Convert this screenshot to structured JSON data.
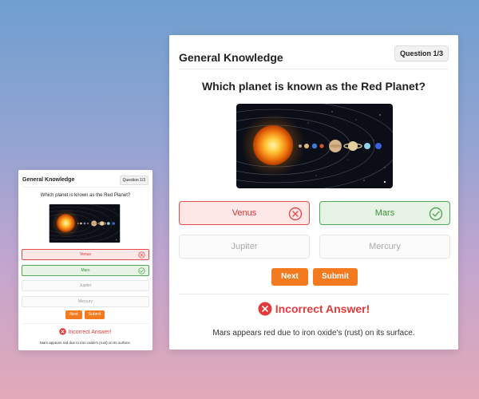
{
  "quiz": {
    "category": "General Knowledge",
    "question_counter": "Question 1/3",
    "question": "Which planet is known as the Red Planet?",
    "image_icon": "solar-system-illustration",
    "options": [
      {
        "label": "Venus",
        "state": "wrong",
        "icon": "x-circle-icon"
      },
      {
        "label": "Mars",
        "state": "correct",
        "icon": "check-circle-icon"
      },
      {
        "label": "Jupiter",
        "state": "neutral"
      },
      {
        "label": "Mercury",
        "state": "neutral"
      }
    ],
    "next_label": "Next",
    "submit_label": "Submit",
    "result_text": "Incorrect Answer!",
    "result_icon": "x-circle-icon",
    "explanation": "Mars appears red due to iron oxide's (rust) on its surface."
  },
  "colors": {
    "accent": "#f37a1f",
    "wrong": "#e34b4b",
    "correct": "#53a653"
  }
}
